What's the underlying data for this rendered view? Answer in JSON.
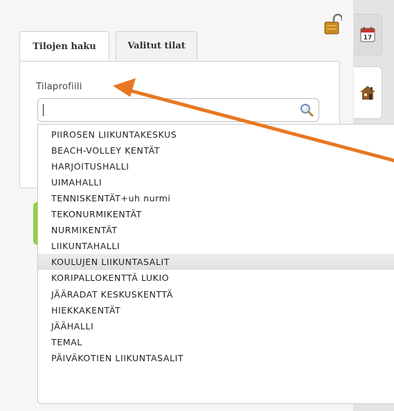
{
  "tabs": [
    {
      "label": "Tilojen haku",
      "active": true
    },
    {
      "label": "Valitut tilat",
      "active": false
    }
  ],
  "search": {
    "label": "Tilaprofiili",
    "value": "",
    "placeholder": ""
  },
  "dropdown": {
    "items": [
      "PIIROSEN LIIKUNTAKESKUS",
      "BEACH-VOLLEY KENTÄT",
      "HARJOITUSHALLI",
      "UIMAHALLI",
      "TENNISKENTÄT+uh nurmi",
      "TEKONURMIKENTÄT",
      "NURMIKENTÄT",
      "LIIKUNTAHALLI",
      "KOULUJEN LIIKUNTASALIT",
      "KORIPALLOKENTTÄ LUKIO",
      "JÄÄRADAT KESKUSKENTTÄ",
      "HIEKKAKENTÄT",
      "JÄÄHALLI",
      "TEMAL",
      "PÄIVÄKOTIEN LIIKUNTASALIT"
    ],
    "highlighted": "KOULUJEN LIIKUNTASALIT"
  },
  "calendar": {
    "day": "17"
  },
  "colors": {
    "annotation_arrow": "#e87722",
    "accent_green": "#8fd24e",
    "highlight_row": "#e4e4e4"
  },
  "icons": [
    "lock-icon",
    "calendar-icon",
    "home-icon",
    "search-icon"
  ]
}
